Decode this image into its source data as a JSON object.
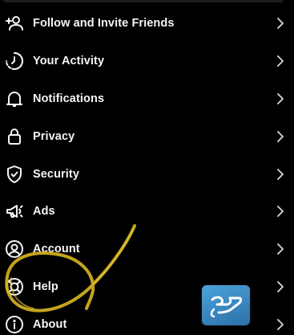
{
  "menu": {
    "items": [
      {
        "label": "Follow and Invite Friends",
        "icon": "add-person-icon"
      },
      {
        "label": "Your Activity",
        "icon": "activity-icon"
      },
      {
        "label": "Notifications",
        "icon": "bell-icon"
      },
      {
        "label": "Privacy",
        "icon": "lock-icon"
      },
      {
        "label": "Security",
        "icon": "shield-check-icon"
      },
      {
        "label": "Ads",
        "icon": "megaphone-icon"
      },
      {
        "label": "Account",
        "icon": "account-circle-icon"
      },
      {
        "label": "Help",
        "icon": "lifebuoy-icon"
      },
      {
        "label": "About",
        "icon": "info-icon"
      }
    ]
  },
  "colors": {
    "background": "#000000",
    "text": "#f5f5f5",
    "scribble": "#d4b21f",
    "watermark": "#3a8cc9"
  }
}
